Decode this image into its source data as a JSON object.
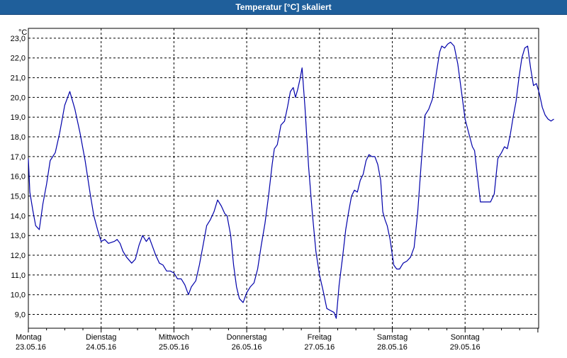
{
  "title": "Temperatur [°C] skaliert",
  "chart_data": {
    "type": "line",
    "title": "Temperatur [°C] skaliert",
    "ylabel": "°C",
    "xlabel": "",
    "ylim": [
      8.3,
      23.5
    ],
    "y_ticks": [
      "23,0",
      "22,0",
      "21,0",
      "20,0",
      "19,0",
      "18,0",
      "17,0",
      "16,0",
      "15,0",
      "14,0",
      "13,0",
      "12,0",
      "11,0",
      "10,0",
      "9,0"
    ],
    "x_days": [
      {
        "day": "Montag",
        "date": "23.05.16"
      },
      {
        "day": "Dienstag",
        "date": "24.05.16"
      },
      {
        "day": "Mittwoch",
        "date": "25.05.16"
      },
      {
        "day": "Donnerstag",
        "date": "26.05.16"
      },
      {
        "day": "Freitag",
        "date": "27.05.16"
      },
      {
        "day": "Samstag",
        "date": "28.05.16"
      },
      {
        "day": "Sonntag",
        "date": "29.05.16"
      }
    ],
    "grid": true,
    "line_color": "#0000aa",
    "series": [
      {
        "x_unit": "day",
        "points": [
          [
            0.0,
            16.9
          ],
          [
            0.02,
            15.2
          ],
          [
            0.06,
            14.3
          ],
          [
            0.1,
            13.5
          ],
          [
            0.15,
            13.3
          ],
          [
            0.2,
            14.6
          ],
          [
            0.25,
            15.6
          ],
          [
            0.3,
            16.8
          ],
          [
            0.37,
            17.2
          ],
          [
            0.43,
            18.2
          ],
          [
            0.5,
            19.6
          ],
          [
            0.57,
            20.3
          ],
          [
            0.64,
            19.4
          ],
          [
            0.71,
            18.2
          ],
          [
            0.78,
            16.8
          ],
          [
            0.85,
            15.1
          ],
          [
            0.9,
            14.0
          ],
          [
            0.95,
            13.3
          ],
          [
            1.0,
            12.7
          ],
          [
            1.05,
            12.8
          ],
          [
            1.1,
            12.6
          ],
          [
            1.18,
            12.7
          ],
          [
            1.22,
            12.8
          ],
          [
            1.26,
            12.6
          ],
          [
            1.3,
            12.2
          ],
          [
            1.35,
            11.9
          ],
          [
            1.42,
            11.6
          ],
          [
            1.47,
            11.8
          ],
          [
            1.52,
            12.5
          ],
          [
            1.57,
            13.0
          ],
          [
            1.62,
            12.7
          ],
          [
            1.66,
            12.9
          ],
          [
            1.7,
            12.5
          ],
          [
            1.75,
            12.0
          ],
          [
            1.8,
            11.6
          ],
          [
            1.85,
            11.5
          ],
          [
            1.9,
            11.2
          ],
          [
            1.95,
            11.2
          ],
          [
            2.0,
            11.1
          ],
          [
            2.05,
            10.8
          ],
          [
            2.1,
            10.8
          ],
          [
            2.15,
            10.5
          ],
          [
            2.2,
            10.0
          ],
          [
            2.24,
            10.4
          ],
          [
            2.3,
            10.7
          ],
          [
            2.35,
            11.5
          ],
          [
            2.4,
            12.5
          ],
          [
            2.45,
            13.5
          ],
          [
            2.5,
            13.8
          ],
          [
            2.55,
            14.2
          ],
          [
            2.6,
            14.8
          ],
          [
            2.65,
            14.5
          ],
          [
            2.7,
            14.1
          ],
          [
            2.73,
            14.0
          ],
          [
            2.78,
            13.0
          ],
          [
            2.82,
            11.5
          ],
          [
            2.86,
            10.4
          ],
          [
            2.9,
            9.8
          ],
          [
            2.95,
            9.6
          ],
          [
            3.0,
            10.1
          ],
          [
            3.05,
            10.4
          ],
          [
            3.1,
            10.6
          ],
          [
            3.15,
            11.3
          ],
          [
            3.2,
            12.5
          ],
          [
            3.25,
            13.6
          ],
          [
            3.3,
            15.0
          ],
          [
            3.35,
            16.6
          ],
          [
            3.38,
            17.4
          ],
          [
            3.42,
            17.6
          ],
          [
            3.47,
            18.6
          ],
          [
            3.52,
            18.8
          ],
          [
            3.56,
            19.5
          ],
          [
            3.6,
            20.3
          ],
          [
            3.64,
            20.5
          ],
          [
            3.67,
            20.0
          ],
          [
            3.7,
            20.4
          ],
          [
            3.73,
            20.9
          ],
          [
            3.76,
            21.5
          ],
          [
            3.8,
            19.5
          ],
          [
            3.85,
            16.5
          ],
          [
            3.9,
            14.2
          ],
          [
            3.95,
            12.2
          ],
          [
            4.0,
            11.0
          ],
          [
            4.05,
            10.2
          ],
          [
            4.1,
            9.3
          ],
          [
            4.15,
            9.2
          ],
          [
            4.2,
            9.1
          ],
          [
            4.23,
            8.8
          ],
          [
            4.27,
            10.5
          ],
          [
            4.32,
            12.0
          ],
          [
            4.36,
            13.3
          ],
          [
            4.4,
            14.2
          ],
          [
            4.44,
            15.0
          ],
          [
            4.48,
            15.3
          ],
          [
            4.52,
            15.2
          ],
          [
            4.56,
            15.8
          ],
          [
            4.6,
            16.1
          ],
          [
            4.64,
            16.8
          ],
          [
            4.68,
            17.1
          ],
          [
            4.72,
            17.0
          ],
          [
            4.76,
            17.0
          ],
          [
            4.8,
            16.6
          ],
          [
            4.84,
            15.8
          ],
          [
            4.87,
            14.2
          ],
          [
            4.9,
            13.8
          ],
          [
            4.93,
            13.5
          ],
          [
            4.97,
            12.8
          ],
          [
            5.02,
            11.5
          ],
          [
            5.06,
            11.3
          ],
          [
            5.1,
            11.3
          ],
          [
            5.15,
            11.6
          ],
          [
            5.2,
            11.7
          ],
          [
            5.25,
            11.9
          ],
          [
            5.3,
            12.4
          ],
          [
            5.35,
            14.2
          ],
          [
            5.4,
            16.8
          ],
          [
            5.45,
            19.1
          ],
          [
            5.5,
            19.4
          ],
          [
            5.55,
            19.9
          ],
          [
            5.6,
            21.1
          ],
          [
            5.65,
            22.3
          ],
          [
            5.68,
            22.6
          ],
          [
            5.72,
            22.5
          ],
          [
            5.76,
            22.7
          ],
          [
            5.8,
            22.8
          ],
          [
            5.85,
            22.6
          ],
          [
            5.9,
            21.7
          ],
          [
            5.95,
            20.3
          ],
          [
            6.0,
            18.9
          ],
          [
            6.05,
            18.2
          ],
          [
            6.1,
            17.5
          ],
          [
            6.13,
            17.3
          ],
          [
            6.17,
            16.0
          ],
          [
            6.21,
            14.7
          ],
          [
            6.25,
            14.7
          ],
          [
            6.3,
            14.7
          ],
          [
            6.35,
            14.7
          ],
          [
            6.4,
            15.1
          ],
          [
            6.45,
            16.9
          ],
          [
            6.5,
            17.2
          ],
          [
            6.54,
            17.5
          ],
          [
            6.58,
            17.4
          ],
          [
            6.62,
            18.1
          ],
          [
            6.66,
            19.0
          ],
          [
            6.7,
            19.8
          ],
          [
            6.74,
            21.0
          ],
          [
            6.78,
            22.0
          ],
          [
            6.82,
            22.5
          ],
          [
            6.86,
            22.6
          ],
          [
            6.9,
            21.5
          ],
          [
            6.94,
            20.6
          ],
          [
            6.98,
            20.7
          ],
          [
            7.02,
            20.2
          ],
          [
            7.06,
            19.5
          ],
          [
            7.1,
            19.1
          ],
          [
            7.14,
            18.9
          ],
          [
            7.18,
            18.8
          ],
          [
            7.22,
            18.9
          ]
        ]
      }
    ]
  }
}
